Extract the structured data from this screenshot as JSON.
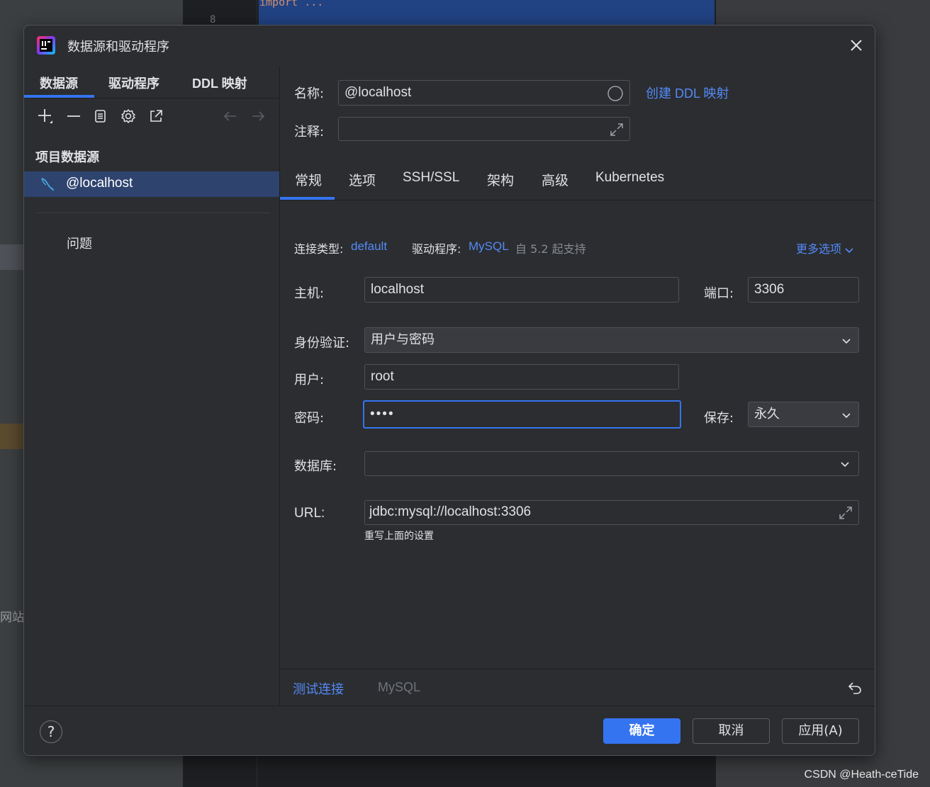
{
  "background": {
    "line_number": "8",
    "code_snippet": "import ...",
    "sidebar_text": "网站\\",
    "watermark": "CSDN @Heath-ceTide"
  },
  "dialog": {
    "title": "数据源和驱动程序",
    "left_tabs": [
      "数据源",
      "驱动程序",
      "DDL 映射"
    ],
    "section_title": "项目数据源",
    "datasource_item": "@localhost",
    "problems": "问题"
  },
  "form": {
    "name_label": "名称:",
    "name_value": "@localhost",
    "create_ddl_link": "创建 DDL 映射",
    "comment_label": "注释:",
    "comment_value": "",
    "tabs": [
      "常规",
      "选项",
      "SSH/SSL",
      "架构",
      "高级",
      "Kubernetes"
    ],
    "connection_type_label": "连接类型:",
    "connection_type_value": "default",
    "driver_label": "驱动程序:",
    "driver_value": "MySQL",
    "driver_support": "自 5.2 起支持",
    "more_options": "更多选项",
    "host_label": "主机:",
    "host_value": "localhost",
    "port_label": "端口:",
    "port_value": "3306",
    "auth_label": "身份验证:",
    "auth_value": "用户与密码",
    "user_label": "用户:",
    "user_value": "root",
    "password_label": "密码:",
    "password_value": "••••",
    "save_label": "保存:",
    "save_value": "永久",
    "database_label": "数据库:",
    "database_value": "",
    "url_label": "URL:",
    "url_value": "jdbc:mysql://localhost:3306",
    "url_hint": "重写上面的设置"
  },
  "bottom": {
    "test_connection": "测试连接",
    "driver_name": "MySQL"
  },
  "footer": {
    "help": "?",
    "ok": "确定",
    "cancel": "取消",
    "apply": "应用(A)"
  },
  "colors": {
    "accent": "#3574f0",
    "link": "#548af7",
    "selection": "#2e436e",
    "dialog_bg": "#2b2d30"
  }
}
